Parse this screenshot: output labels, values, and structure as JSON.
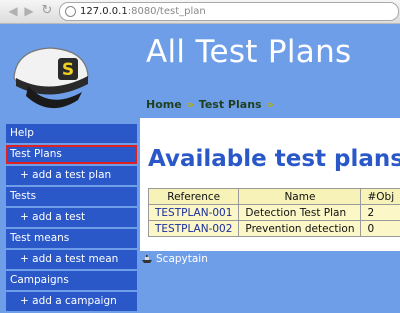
{
  "browser": {
    "url_host": "127.0.0.1",
    "url_rest": ":8080/test_plan"
  },
  "header": {
    "title": "All Test Plans",
    "breadcrumb": [
      "Home",
      "Test Plans"
    ]
  },
  "sidebar": {
    "items": [
      {
        "label": "Help"
      },
      {
        "label": "Test Plans"
      },
      {
        "label": "+ add a test plan"
      },
      {
        "label": "Tests"
      },
      {
        "label": "+ add a test"
      },
      {
        "label": "Test means"
      },
      {
        "label": "+ add a test mean"
      },
      {
        "label": "Campaigns"
      },
      {
        "label": "+ add a campaign"
      }
    ]
  },
  "main": {
    "heading": "Available test plans",
    "table": {
      "columns": [
        "Reference",
        "Name",
        "#Obj"
      ],
      "rows": [
        {
          "ref": "TESTPLAN-001",
          "name": "Detection Test Plan",
          "obj": "2"
        },
        {
          "ref": "TESTPLAN-002",
          "name": "Prevention detection",
          "obj": "0"
        }
      ]
    }
  },
  "footer": {
    "label": "Scapytain"
  },
  "colors": {
    "background": "#6e9ee8",
    "sidebar_item": "#2a58c9",
    "heading": "#2a58c9",
    "table_cell": "#fbf7c6",
    "active_outline": "#e02020"
  }
}
